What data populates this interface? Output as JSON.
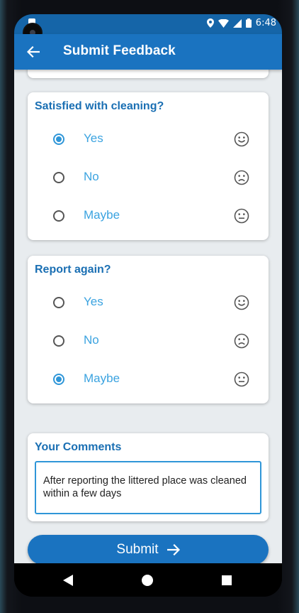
{
  "status_bar": {
    "time": "6:48",
    "icons": [
      "location-icon",
      "wifi-icon",
      "signal-icon",
      "battery-icon"
    ]
  },
  "app_bar": {
    "back_icon": "arrow-left-icon",
    "title": "Submit Feedback"
  },
  "questions": [
    {
      "title": "Satisfied with cleaning?",
      "options": [
        {
          "label": "Yes",
          "selected": true,
          "face": "smile-face-icon"
        },
        {
          "label": "No",
          "selected": false,
          "face": "frown-face-icon"
        },
        {
          "label": "Maybe",
          "selected": false,
          "face": "neutral-face-icon"
        }
      ]
    },
    {
      "title": "Report again?",
      "options": [
        {
          "label": "Yes",
          "selected": false,
          "face": "smile-face-icon"
        },
        {
          "label": "No",
          "selected": false,
          "face": "frown-face-icon"
        },
        {
          "label": "Maybe",
          "selected": true,
          "face": "neutral-face-icon"
        }
      ]
    }
  ],
  "comments": {
    "title": "Your Comments",
    "value": "After reporting the littered place was cleaned within a few days"
  },
  "submit": {
    "label": "Submit",
    "icon": "arrow-right-icon"
  },
  "nav": [
    "back-triangle-icon",
    "home-circle-icon",
    "recents-square-icon"
  ],
  "colors": {
    "primary": "#1a73c0",
    "accent": "#2f96d8",
    "option_text": "#3ba3e0",
    "background": "#e8ecef"
  }
}
